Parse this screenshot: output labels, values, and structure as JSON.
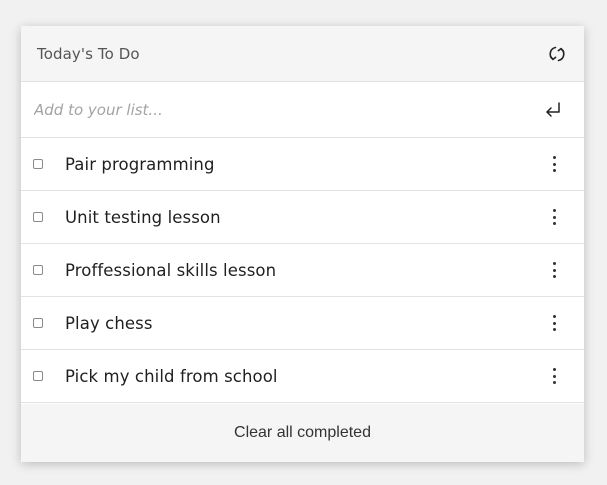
{
  "header": {
    "title": "Today's To Do",
    "refresh_icon": "refresh-icon"
  },
  "add_item": {
    "placeholder": "Add to your list...",
    "value": "",
    "submit_icon": "enter-icon"
  },
  "todos": [
    {
      "label": "Pair programming",
      "completed": false
    },
    {
      "label": "Unit testing lesson",
      "completed": false
    },
    {
      "label": "Proffessional skills lesson",
      "completed": false
    },
    {
      "label": "Play chess",
      "completed": false
    },
    {
      "label": "Pick my child from school",
      "completed": false
    }
  ],
  "footer": {
    "clear_label": "Clear all completed"
  },
  "colors": {
    "page_background": "#f1f1f1",
    "card_background": "#ffffff",
    "header_background": "#f5f5f5",
    "divider": "#e2e2e2",
    "placeholder": "#a3a3a3",
    "text": "#1f1f1f"
  }
}
